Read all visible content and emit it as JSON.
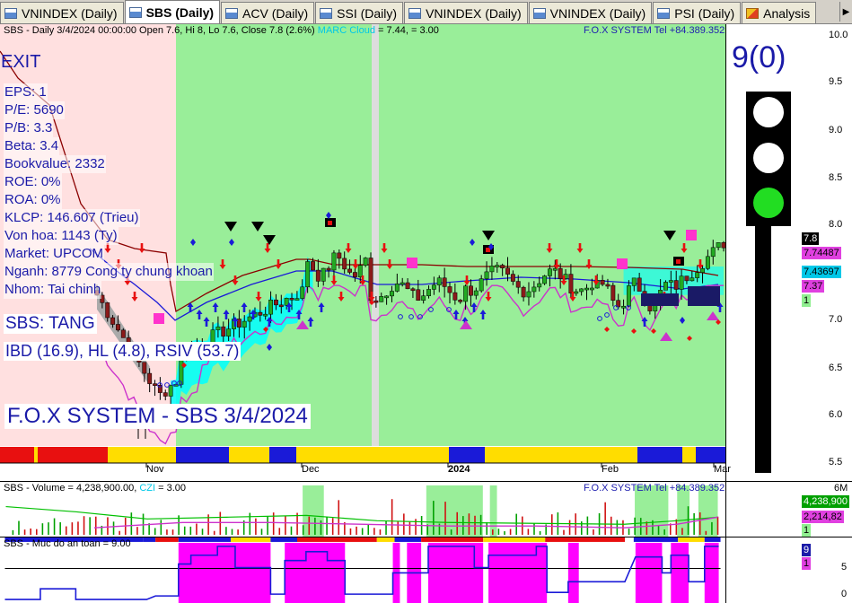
{
  "tabs": [
    {
      "label": "VNINDEX (Daily)",
      "active": false
    },
    {
      "label": "SBS (Daily)",
      "active": true
    },
    {
      "label": "ACV (Daily)",
      "active": false
    },
    {
      "label": "SSI (Daily)",
      "active": false
    },
    {
      "label": "VNINDEX (Daily)",
      "active": false
    },
    {
      "label": "VNINDEX (Daily)",
      "active": false
    },
    {
      "label": "PSI (Daily)",
      "active": false
    },
    {
      "label": "Analysis",
      "active": false
    }
  ],
  "main": {
    "header_prefix": "SBS - Daily 3/4/2024 00:00:00 Open 7.6, Hi 8, Lo 7.6, Close 7.8 (2.6%)",
    "header_indicator": "MARC Cloud",
    "header_values": "= 7.44,   = 3.00",
    "header_right": "F.O.X SYSTEM Tel +84.389.352.357",
    "signal": "EXIT",
    "fundamentals": [
      "EPS: 1",
      "P/E: 5690",
      "P/B: 3.3",
      "Beta: 3.4",
      "Bookvalue: 2332",
      "ROE: 0%",
      "ROA: 0%",
      "KLCP: 146.607 (Trieu)",
      "Von hoa: 1143 (Ty)",
      "Market: UPCOM",
      "Nganh: 8779 Cong ty chung khoan",
      "Nhom: Tai chinh"
    ],
    "trend": "SBS: TANG",
    "ratings": "IBD (16.9), HL (4.8), RSIV (53.7)",
    "banner": "F.O.X SYSTEM - SBS 3/4/2024",
    "score": "9(0)",
    "price_ticks": [
      "10.0",
      "9.5",
      "9.0",
      "8.5",
      "8.0",
      "7.0",
      "6.5",
      "6.0",
      "5.5"
    ],
    "price_badges": [
      {
        "text": "7.8",
        "bg": "#000000",
        "fg": "#ffffff"
      },
      {
        "text": "7.74487",
        "bg": "#e040e0",
        "fg": "#000000"
      },
      {
        "text": "7.43697",
        "bg": "#00c8e8",
        "fg": "#000000"
      },
      {
        "text": "7.37",
        "bg": "#e040e0",
        "fg": "#000000"
      },
      {
        "text": "1",
        "bg": "#90ee90",
        "fg": "#000000"
      }
    ],
    "x_labels": [
      {
        "text": "Nov",
        "bold": false
      },
      {
        "text": "Dec",
        "bold": false
      },
      {
        "text": "2024",
        "bold": true
      },
      {
        "text": "Feb",
        "bold": false
      },
      {
        "text": "Mar",
        "bold": false
      }
    ]
  },
  "volume": {
    "header_prefix": "SBS - Volume = 4,238,900.00,",
    "header_indicator": "CZI",
    "header_values": "= 3.00",
    "header_right": "F.O.X SYSTEM Tel +84.389.352.357",
    "axis_top": "6M",
    "badges": [
      {
        "text": "4,238,900",
        "bg": "#00a000",
        "fg": "#ffffff"
      },
      {
        "text": "2,214,82",
        "bg": "#e040e0",
        "fg": "#000000"
      },
      {
        "text": "1",
        "bg": "#90ee90",
        "fg": "#000000"
      }
    ]
  },
  "safety": {
    "header": "SBS - Muc do an toan = 9.00",
    "ticks": [
      "5",
      "0"
    ],
    "badges": [
      {
        "text": "9",
        "bg": "#1a1aa8",
        "fg": "#ffffff"
      },
      {
        "text": "1",
        "bg": "#e040e0",
        "fg": "#000000"
      }
    ]
  },
  "colors": {
    "bull_zone": "#99ee99",
    "bear_zone": "#ffe0e0",
    "up_candle": "#22aa22",
    "down_candle": "#8b1a1a",
    "cloud": "#00ffff",
    "ma_magenta": "#cc33cc",
    "ma_blue": "#1a1ad8",
    "ma_maroon": "#8b0000",
    "arrow_up": "#1a1ad8",
    "arrow_down": "#e81010",
    "safety_fill": "#ff00ff",
    "light_off": "#ffffff",
    "light_on": "#22dd22"
  }
}
